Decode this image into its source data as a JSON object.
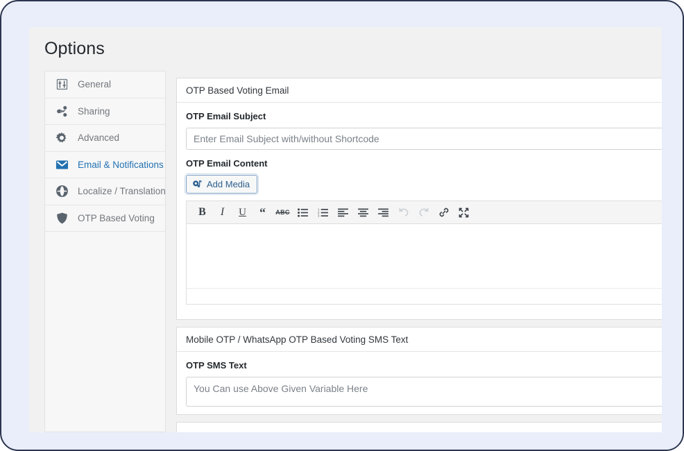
{
  "page": {
    "title": "Options"
  },
  "sidebar": {
    "items": [
      {
        "label": "General",
        "icon": "sliders-icon",
        "active": false
      },
      {
        "label": "Sharing",
        "icon": "share-icon",
        "active": false
      },
      {
        "label": "Advanced",
        "icon": "gear-icon",
        "active": false
      },
      {
        "label": "Email & Notifications",
        "icon": "envelope-icon",
        "active": true
      },
      {
        "label": "Localize / Translation",
        "icon": "globe-icon",
        "active": false
      },
      {
        "label": "OTP Based Voting",
        "icon": "shield-icon",
        "active": false
      }
    ]
  },
  "email_panel": {
    "heading": "OTP Based Voting Email",
    "subject_label": "OTP Email Subject",
    "subject_value": "",
    "subject_placeholder": "Enter Email Subject with/without Shortcode",
    "content_label": "OTP Email Content",
    "add_media_label": "Add Media",
    "add_media_icon": "media-icon",
    "editor_value": "",
    "toolbar": [
      {
        "name": "bold-icon",
        "glyph": "B",
        "disabled": false
      },
      {
        "name": "italic-icon",
        "glyph": "I",
        "disabled": false
      },
      {
        "name": "underline-icon",
        "glyph": "U",
        "disabled": false
      },
      {
        "name": "blockquote-icon",
        "glyph": "“",
        "disabled": false
      },
      {
        "name": "strikethrough-icon",
        "glyph": "ABC",
        "disabled": false
      },
      {
        "name": "bulleted-list-icon",
        "glyph": "",
        "disabled": false
      },
      {
        "name": "numbered-list-icon",
        "glyph": "",
        "disabled": false
      },
      {
        "name": "align-left-icon",
        "glyph": "",
        "disabled": false
      },
      {
        "name": "align-center-icon",
        "glyph": "",
        "disabled": false
      },
      {
        "name": "align-right-icon",
        "glyph": "",
        "disabled": false
      },
      {
        "name": "undo-icon",
        "glyph": "",
        "disabled": true
      },
      {
        "name": "redo-icon",
        "glyph": "",
        "disabled": true
      },
      {
        "name": "link-icon",
        "glyph": "",
        "disabled": false
      },
      {
        "name": "fullscreen-icon",
        "glyph": "",
        "disabled": false
      }
    ]
  },
  "sms_panel": {
    "heading": "Mobile OTP / WhatsApp OTP Based Voting SMS Text",
    "sms_label": "OTP SMS Text",
    "sms_value": "",
    "sms_placeholder": "You Can use Above Given Variable Here"
  },
  "colors": {
    "accent": "#2271b1",
    "outer_bg": "#e9eefa",
    "header_bg": "#f1f1f1",
    "sidebar_bg": "#f7f7f7",
    "border": "#dcdcdc",
    "text": "#32373c",
    "muted_text": "#72777c"
  }
}
